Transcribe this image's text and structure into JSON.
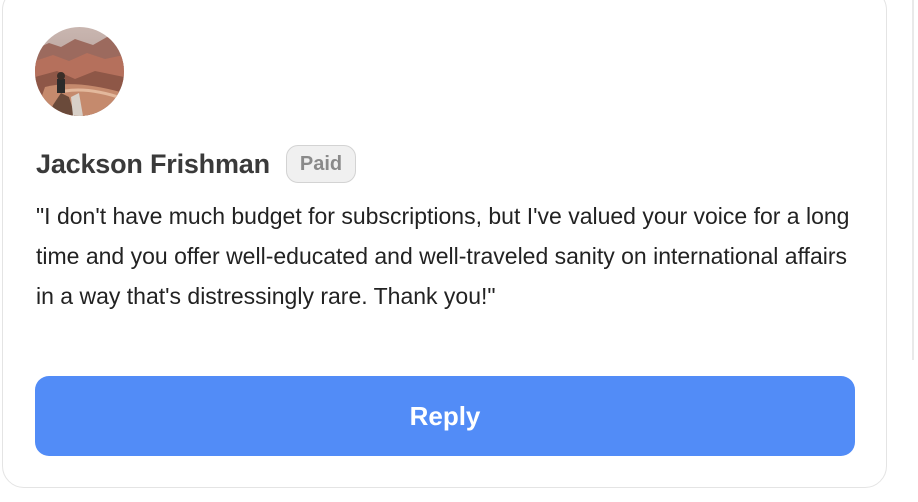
{
  "comment": {
    "author_name": "Jackson Frishman",
    "badge": "Paid",
    "avatar_icon": "canyon-photo",
    "text": "\"I don't have much budget for subscriptions, but I've valued your voice for a long time and you offer well-educated and well-traveled sanity on international affairs in a way that's distressingly rare. Thank you!\"",
    "reply_label": "Reply"
  },
  "colors": {
    "reply_button": "#528cf7",
    "badge_background": "#f0f0f0",
    "badge_text": "#8a8a8a",
    "name_text": "#3a3a3a"
  }
}
